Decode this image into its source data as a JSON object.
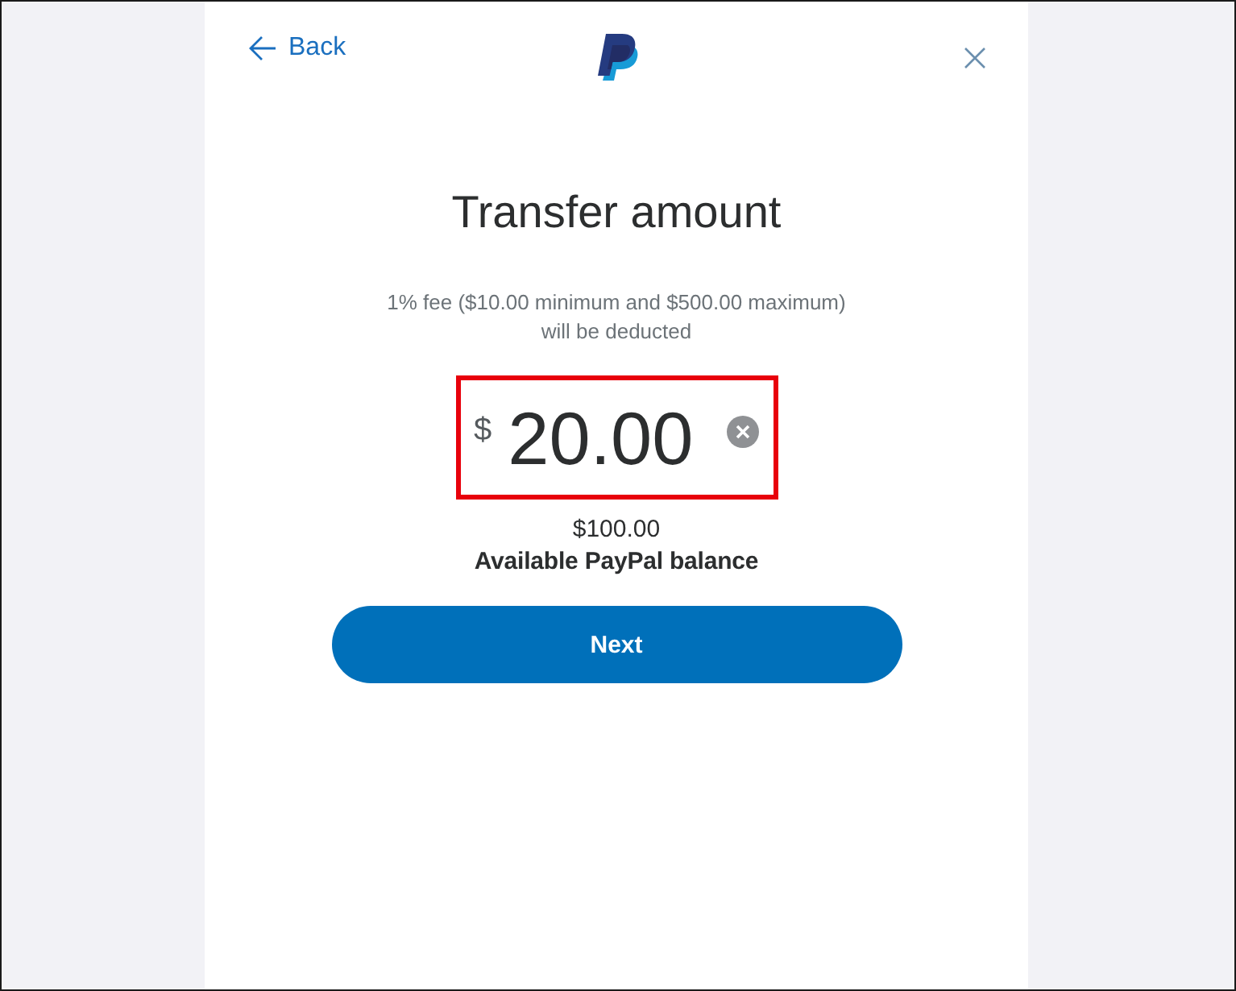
{
  "header": {
    "back_label": "Back"
  },
  "title": "Transfer amount",
  "fee_note": {
    "lines": [
      "1% fee ($10.00 minimum and $500.00 maximum)",
      "will be deducted"
    ]
  },
  "amount": {
    "currency": "$",
    "value": "20.00",
    "highlighted": true
  },
  "balance": {
    "amount": "$100.00",
    "label": "Available PayPal balance"
  },
  "next_button": {
    "label": "Next"
  }
}
